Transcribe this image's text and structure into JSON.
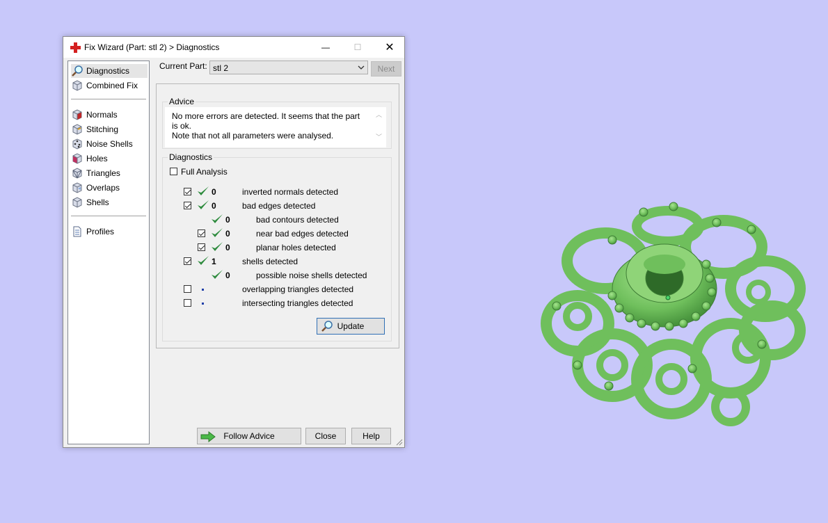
{
  "window": {
    "title": "Fix Wizard (Part: stl 2) > Diagnostics",
    "minimize_symbol": "—",
    "maximize_symbol": "☐",
    "close_symbol": "✕"
  },
  "sidebar": {
    "items": [
      {
        "label": "Diagnostics",
        "icon": "magnifier-icon"
      },
      {
        "label": "Combined Fix",
        "icon": "cube-icon"
      },
      {
        "label": "Normals",
        "icon": "cube-normals-icon"
      },
      {
        "label": "Stitching",
        "icon": "cube-stitching-icon"
      },
      {
        "label": "Noise Shells",
        "icon": "cube-noise-icon"
      },
      {
        "label": "Holes",
        "icon": "cube-holes-icon"
      },
      {
        "label": "Triangles",
        "icon": "cube-triangles-icon"
      },
      {
        "label": "Overlaps",
        "icon": "cube-overlaps-icon"
      },
      {
        "label": "Shells",
        "icon": "cube-shells-icon"
      },
      {
        "label": "Profiles",
        "icon": "document-icon"
      }
    ]
  },
  "header": {
    "current_part_label": "Current Part:",
    "current_part_value": "stl 2",
    "next_label": "Next"
  },
  "advice": {
    "title": "Advice",
    "line1": "No more errors are detected. It seems that the part is ok.",
    "line2": "Note that not all parameters were analysed."
  },
  "diagnostics": {
    "title": "Diagnostics",
    "full_analysis_label": "Full Analysis",
    "rows": [
      {
        "count": "0",
        "label": "inverted normals detected"
      },
      {
        "count": "0",
        "label": "bad edges detected"
      },
      {
        "count": "0",
        "label": "bad contours detected"
      },
      {
        "count": "0",
        "label": "near bad edges detected"
      },
      {
        "count": "0",
        "label": "planar holes detected"
      },
      {
        "count": "1",
        "label": "shells detected"
      },
      {
        "count": "0",
        "label": "possible noise shells detected"
      },
      {
        "count": "",
        "label": "overlapping triangles detected"
      },
      {
        "count": "",
        "label": "intersecting triangles detected"
      }
    ],
    "update_label": "Update"
  },
  "footer": {
    "follow_advice_label": "Follow Advice",
    "close_label": "Close",
    "help_label": "Help"
  },
  "colors": {
    "background": "#c8c8fa",
    "check_green": "#2e8b3e",
    "model_green": "#7ccc6a"
  }
}
